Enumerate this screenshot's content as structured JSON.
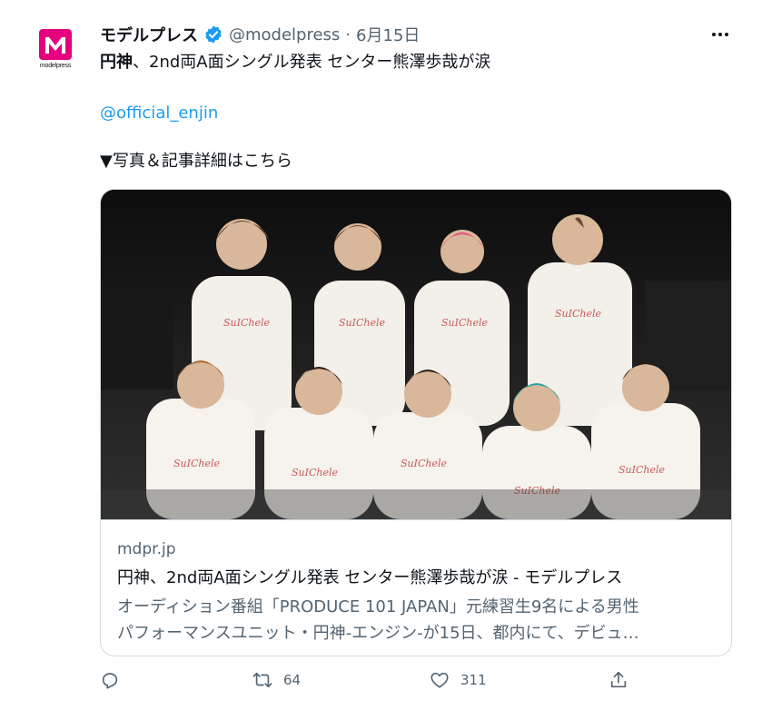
{
  "tweet": {
    "avatar_brand": "modelpress",
    "display_name": "モデルプレス",
    "handle": "@modelpress",
    "separator": "·",
    "date": "6月15日",
    "text_bold": "円神",
    "text_rest": "、2nd両A面シングル発表 センター熊澤歩哉が涙",
    "mention": "@official_enjin",
    "link_line": "▼写真＆記事詳細はこちら"
  },
  "card": {
    "domain": "mdpr.jp",
    "title": "円神、2nd両A面シングル発表 センター熊澤歩哉が涙 - モデルプレス",
    "description_line1": "オーディション番組「PRODUCE 101 JAPAN」元練習生9名による男性",
    "description_line2": "パフォーマンスユニット・円神-エンジン-が15日、都内にて、デビュ…"
  },
  "actions": {
    "reply_count": "",
    "retweet_count": "64",
    "like_count": "311"
  },
  "colors": {
    "accent": "#1d9bf0",
    "secondary_text": "#536471",
    "brand": "#e4007f"
  }
}
